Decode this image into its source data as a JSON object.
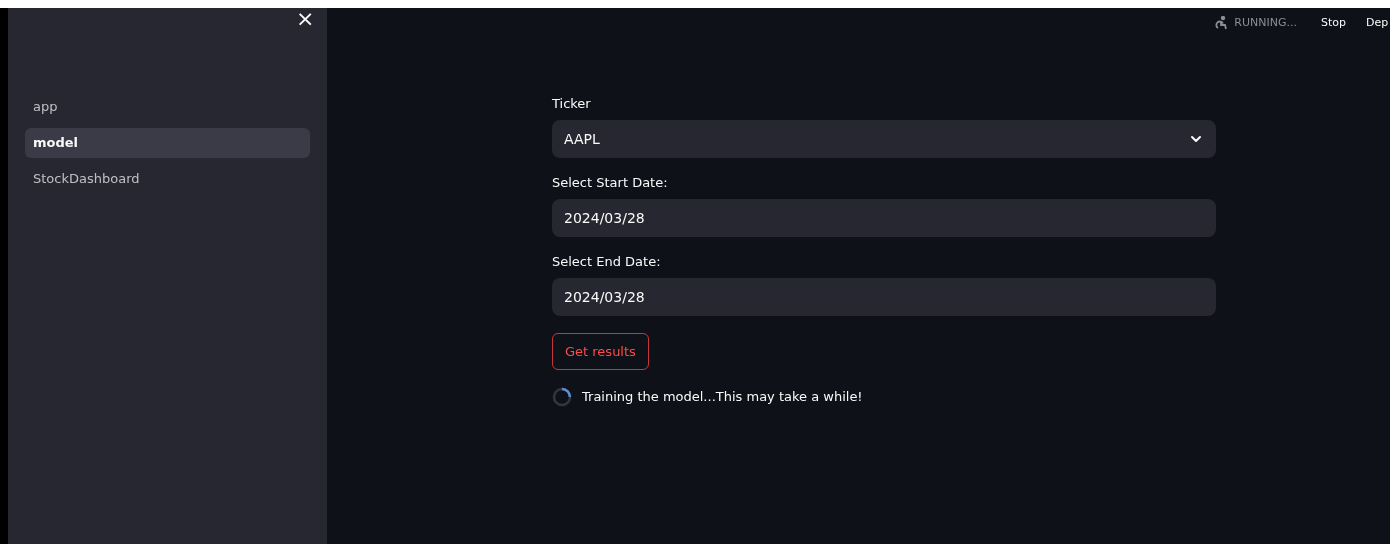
{
  "sidebar": {
    "close": "×",
    "items": [
      {
        "label": "app",
        "selected": false
      },
      {
        "label": "model",
        "selected": true
      },
      {
        "label": "StockDashboard",
        "selected": false
      }
    ]
  },
  "status": {
    "running": "RUNNING...",
    "stop": "Stop",
    "deploy": "Dep"
  },
  "form": {
    "ticker": {
      "label": "Ticker",
      "value": "AAPL"
    },
    "start_date": {
      "label": "Select Start Date:",
      "value": "2024/03/28"
    },
    "end_date": {
      "label": "Select End Date:",
      "value": "2024/03/28"
    },
    "button": "Get results",
    "spinner": "Training the model...This may take a while!"
  }
}
